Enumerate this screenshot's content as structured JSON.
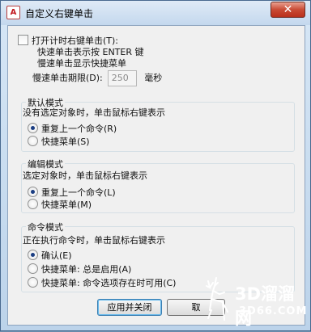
{
  "window": {
    "title": "自定义右键单击",
    "icon_text": "A",
    "close_glyph": "✕"
  },
  "enable_timed_right_click": {
    "label": "打开计时右键单击(T):",
    "checked": false,
    "line1": "快速单击表示按 ENTER 键",
    "line2": "慢速单击显示快捷菜单",
    "duration_label": "慢速单击期限(D):",
    "duration_value": "250",
    "duration_unit": "毫秒"
  },
  "default_mode": {
    "title": "默认模式",
    "description": "没有选定对象时，单击鼠标右键表示",
    "options": [
      {
        "label": "重复上一个命令(R)",
        "selected": true
      },
      {
        "label": "快捷菜单(S)",
        "selected": false
      }
    ]
  },
  "edit_mode": {
    "title": "编辑模式",
    "description": "选定对象时，单击鼠标右键表示",
    "options": [
      {
        "label": "重复上一个命令(L)",
        "selected": true
      },
      {
        "label": "快捷菜单(M)",
        "selected": false
      }
    ]
  },
  "command_mode": {
    "title": "命令模式",
    "description": "正在执行命令时，单击鼠标右键表示",
    "options": [
      {
        "label": "确认(E)",
        "selected": true
      },
      {
        "label": "快捷菜单: 总是启用(A)",
        "selected": false
      },
      {
        "label": "快捷菜单: 命令选项存在时可用(C)",
        "selected": false
      }
    ]
  },
  "buttons": {
    "apply_close": "应用并关闭",
    "cancel_partial": "取"
  },
  "watermark": {
    "logo": "3D溜溜网",
    "url": "3D66.COM"
  },
  "colors": {
    "title_bar": "#c4d8ee",
    "close_button": "#c94a34",
    "dialog_bg": "#f0f0f0"
  }
}
